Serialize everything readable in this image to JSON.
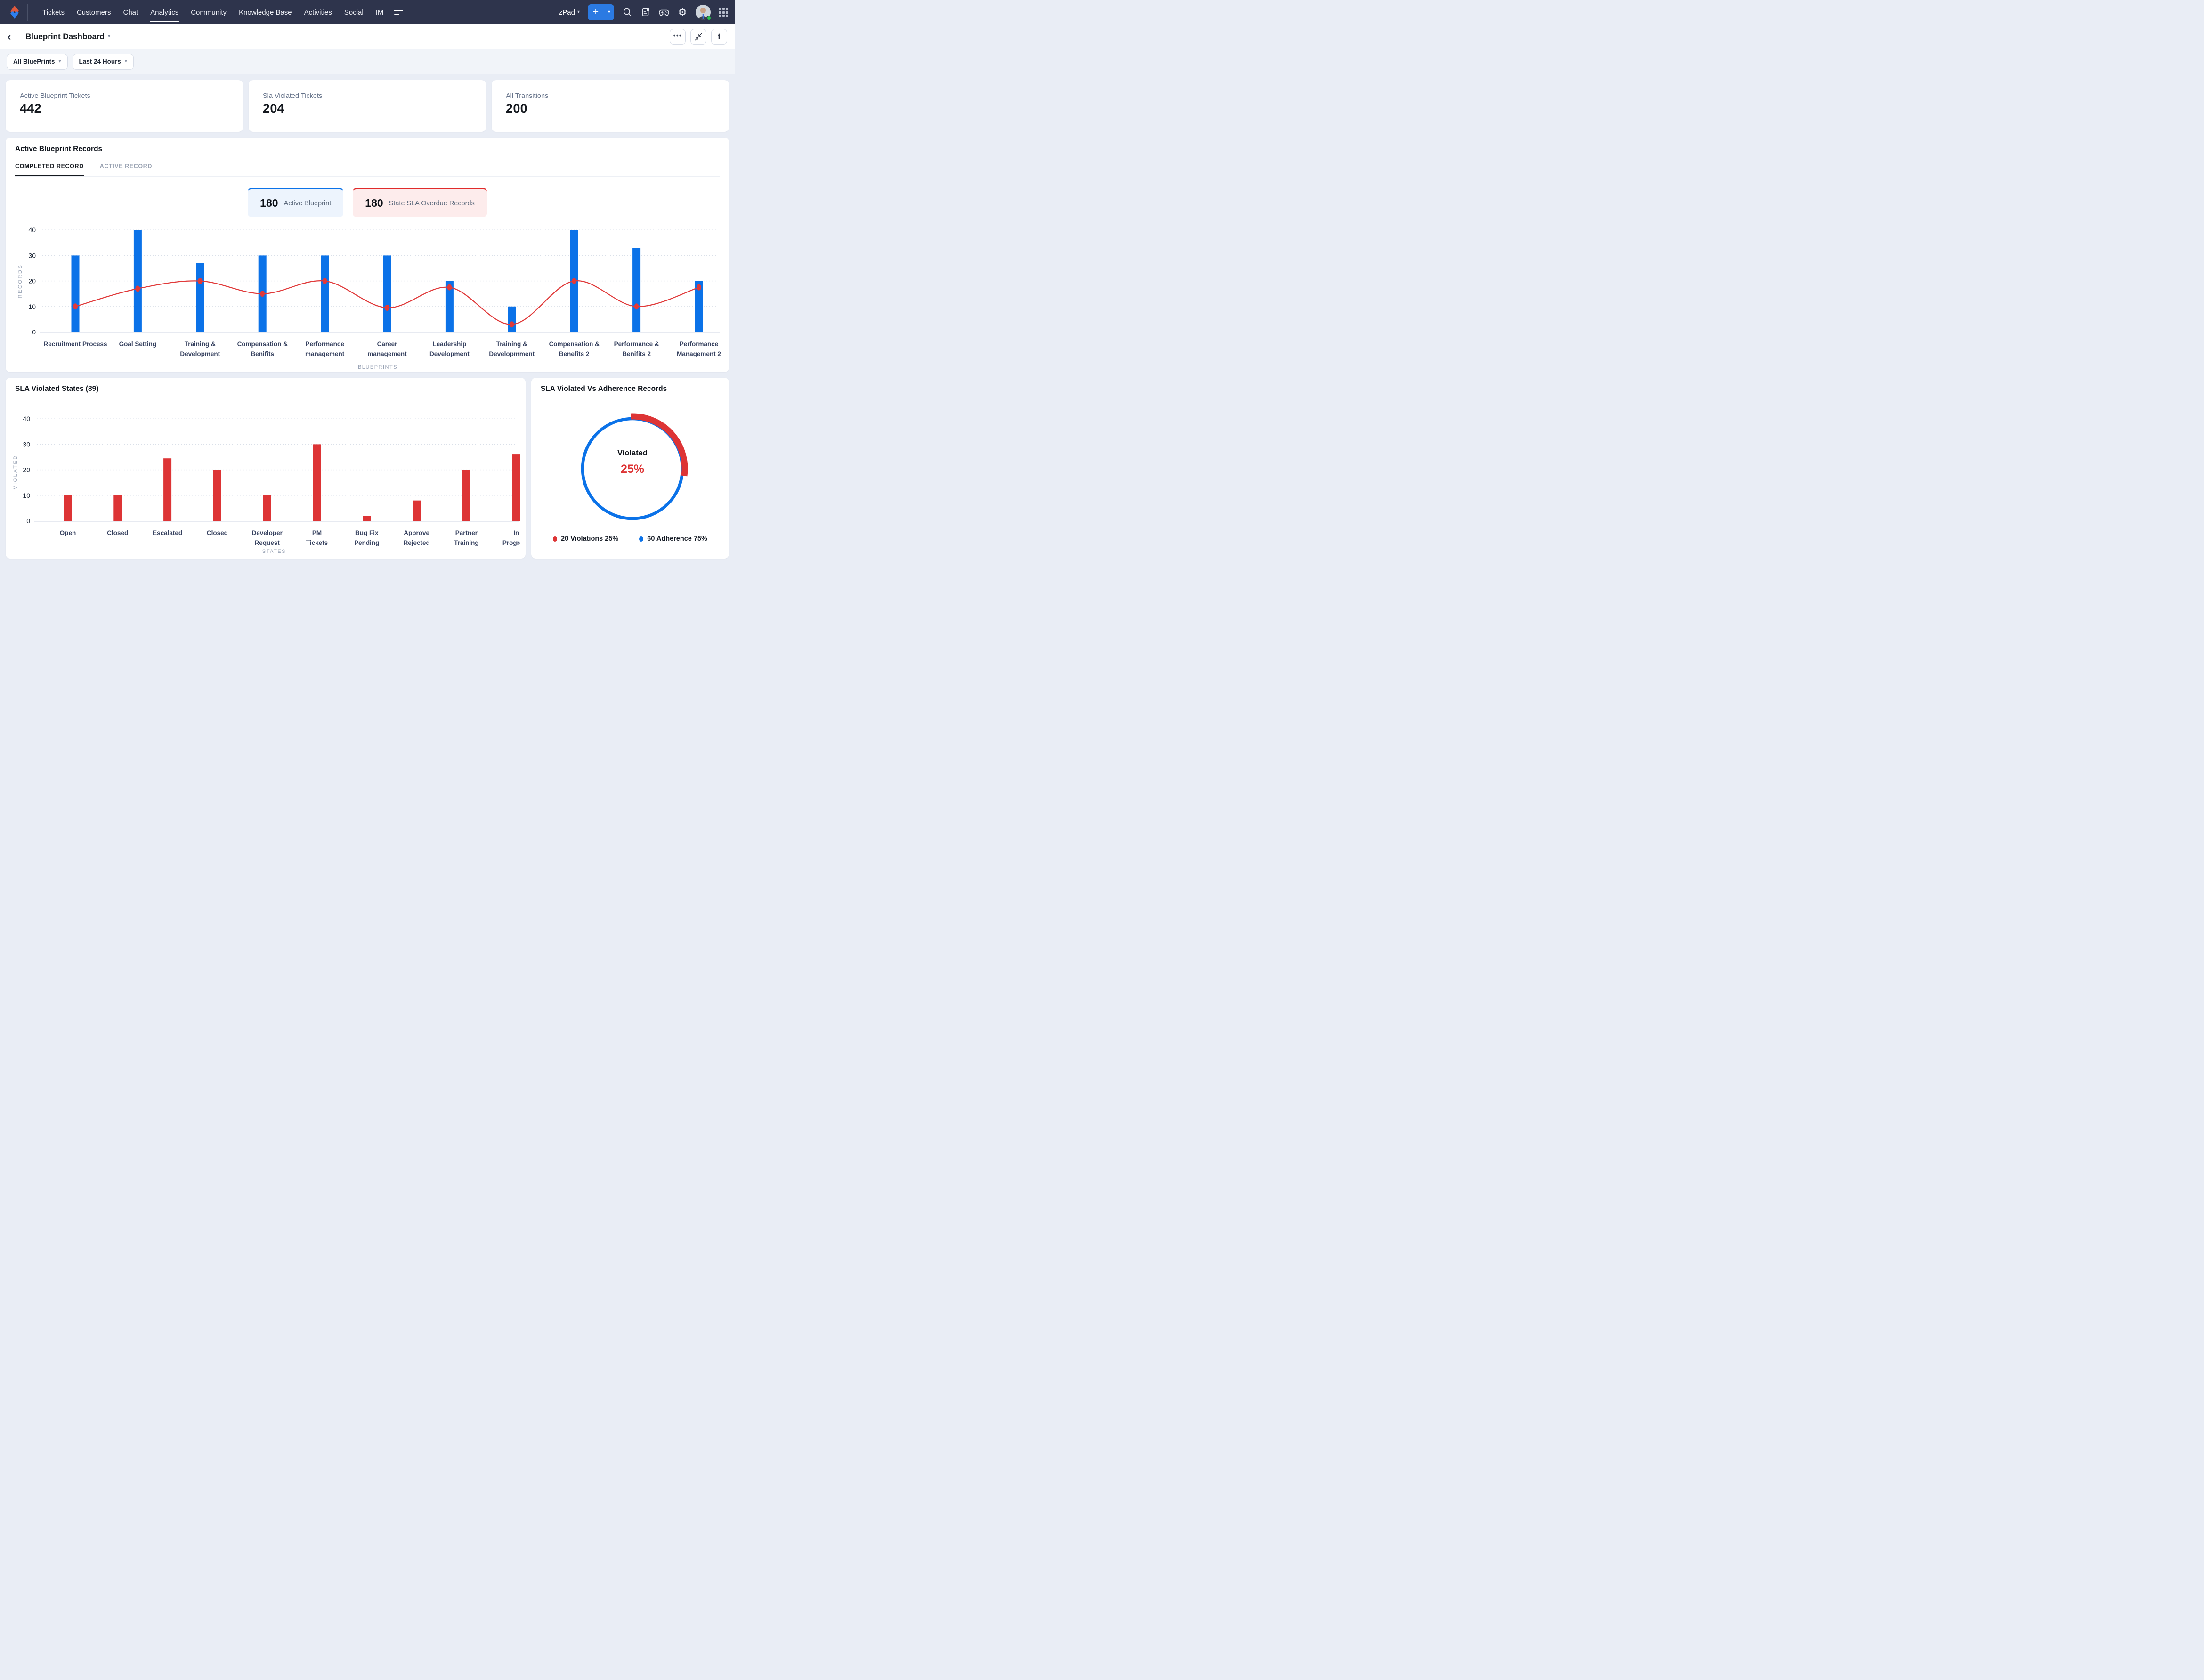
{
  "colors": {
    "nav_bg": "#2e344c",
    "accent_blue": "#0b72e8",
    "red": "#dd3435",
    "page_bg": "#e9edf5",
    "chip_blue_bg": "#edf4fd",
    "chip_red_bg": "#fdecec",
    "status_green": "#27c24c"
  },
  "icons": {
    "back": "‹",
    "caret_down": "▾",
    "more": "•••",
    "info": "i",
    "plus": "+",
    "named": [
      "logo",
      "menu-lines-icon",
      "add-icon",
      "search-icon",
      "feed-icon",
      "gamepad-icon",
      "gear-icon",
      "apps-grid-icon",
      "collapse-icon",
      "info-icon",
      "more-icon",
      "back-icon"
    ]
  },
  "nav": {
    "items": [
      "Tickets",
      "Customers",
      "Chat",
      "Analytics",
      "Community",
      "Knowledge Base",
      "Activities",
      "Social",
      "IM"
    ],
    "active_item": "Analytics",
    "workspace": "zPad",
    "gear_glyph": "⚙"
  },
  "header": {
    "title": "Blueprint Dashboard"
  },
  "filters": {
    "blueprints": "All BluePrints",
    "range": "Last 24 Hours"
  },
  "kpis": [
    {
      "label": "Active Blueprint Tickets",
      "value": "442"
    },
    {
      "label": "Sla Violated Tickets",
      "value": "204"
    },
    {
      "label": "All Transitions",
      "value": "200"
    }
  ],
  "records_panel": {
    "title": "Active Blueprint Records",
    "tabs": [
      {
        "label": "COMPLETED RECORD",
        "active": true
      },
      {
        "label": "ACTIVE RECORD",
        "active": false
      }
    ],
    "chips": [
      {
        "value": "180",
        "label": "Active Blueprint",
        "color": "blue"
      },
      {
        "value": "180",
        "label": "State SLA Overdue Records",
        "color": "red"
      }
    ],
    "chart_data": {
      "type": "bar+line",
      "categories": [
        [
          "Recruitment Process"
        ],
        [
          "Goal Setting"
        ],
        [
          "Training &",
          "Development"
        ],
        [
          "Compensation &",
          "Benifits"
        ],
        [
          "Performance",
          "management"
        ],
        [
          "Career",
          "management"
        ],
        [
          "Leadership",
          "Development"
        ],
        [
          "Training &",
          "Developmment"
        ],
        [
          "Compensation &",
          "Benefits 2"
        ],
        [
          "Performance &",
          "Benifits 2"
        ],
        [
          "Performance",
          "Management 2"
        ]
      ],
      "series": [
        {
          "name": "Records",
          "type": "bar",
          "color": "#0b72e8",
          "values": [
            30,
            40,
            27,
            30,
            30,
            30,
            20,
            10,
            40,
            33,
            20
          ]
        },
        {
          "name": "Trend",
          "type": "line",
          "color": "#e03a3a",
          "values": [
            10,
            17,
            20,
            15,
            20,
            9.5,
            17.5,
            3,
            20,
            10,
            17.5
          ]
        }
      ],
      "yticks": [
        0,
        10,
        20,
        30,
        40
      ],
      "ylim": [
        0,
        43
      ],
      "ylabel": "RECORDS",
      "xlabel": "BLUEPRINTS",
      "grid": "dotted"
    }
  },
  "sla_states_panel": {
    "title": "SLA Violated States (89)",
    "chart_data": {
      "type": "bar",
      "categories": [
        [
          "Open"
        ],
        [
          "Closed"
        ],
        [
          "Escalated"
        ],
        [
          "Closed"
        ],
        [
          "Developer",
          "Request"
        ],
        [
          "PM",
          "Tickets"
        ],
        [
          "Bug Fix",
          "Pending"
        ],
        [
          "Approve",
          "Rejected"
        ],
        [
          "Partner",
          "Training"
        ],
        [
          "In",
          "Progress"
        ]
      ],
      "values": [
        10,
        10,
        24.5,
        20,
        10,
        30,
        2,
        8,
        20,
        26
      ],
      "color": "#dd3435",
      "yticks": [
        0,
        10,
        20,
        30,
        40
      ],
      "ylim": [
        0,
        43
      ],
      "ylabel": "VIOLATED",
      "xlabel": "STATES",
      "grid": "dotted"
    }
  },
  "donut_panel": {
    "title": "SLA Violated Vs Adherence Records",
    "center_label": "Violated",
    "center_value": "25%",
    "chart_data": {
      "type": "donut",
      "slices": [
        {
          "label": "Violations",
          "value": 20,
          "pct": 25,
          "color": "#dd3435"
        },
        {
          "label": "Adherence",
          "value": 60,
          "pct": 75,
          "color": "#0b72e8"
        }
      ],
      "legend": [
        {
          "label": "20 Violations 25%",
          "color": "#dd3435"
        },
        {
          "label": "60 Adherence 75%",
          "color": "#0b72e8"
        }
      ],
      "legend_position": "bottom"
    }
  }
}
